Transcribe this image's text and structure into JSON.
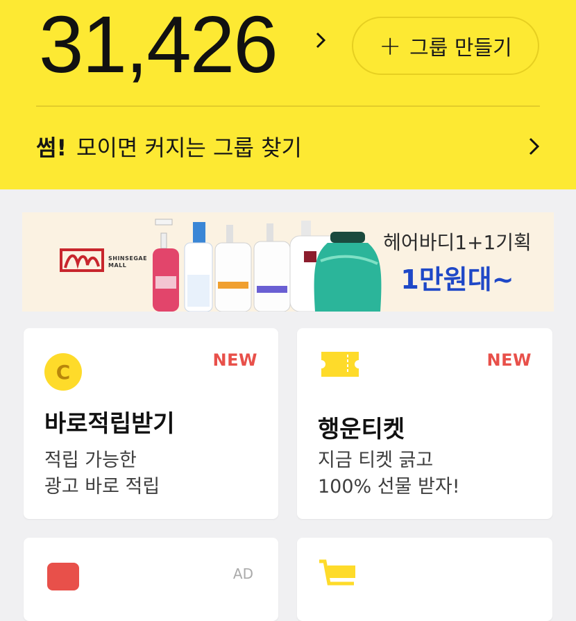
{
  "header": {
    "points": "31,426",
    "create_group_label": "그룹 만들기",
    "promo_highlight": "썸!",
    "promo_text": "모이면 커지는 그룹 찾기"
  },
  "banner": {
    "brand_line1": "SHINSEGAE",
    "brand_line2": "MALL",
    "title": "헤어바디1+1기획",
    "subtitle": "1만원대~"
  },
  "cards": [
    {
      "badge": "NEW",
      "title": "바로적립받기",
      "desc_line1": "적립 가능한",
      "desc_line2": "광고 바로 적립",
      "icon": "coin-icon"
    },
    {
      "badge": "NEW",
      "title": "행운티켓",
      "desc_line1": "지금 티켓 긁고",
      "desc_line2": "100% 선물 받자!",
      "icon": "ticket-icon"
    },
    {
      "badge": "AD",
      "icon": "red-badge-icon"
    },
    {
      "icon": "cart-icon"
    }
  ],
  "colors": {
    "header_bg": "#fde933",
    "new_badge": "#e8504a",
    "banner_accent": "#1f48c7"
  }
}
